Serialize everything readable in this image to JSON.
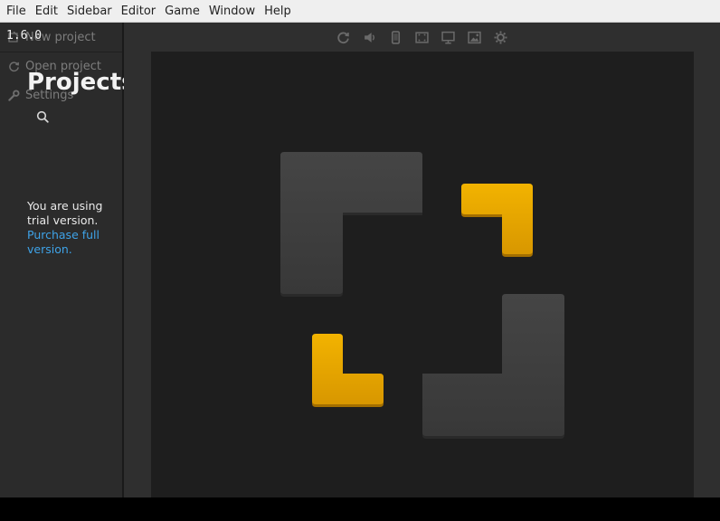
{
  "menubar": {
    "items": [
      "File",
      "Edit",
      "Sidebar",
      "Editor",
      "Game",
      "Window",
      "Help"
    ]
  },
  "sidebar": {
    "version": "1.6.0",
    "new_project": "New project",
    "open_project": "Open project",
    "settings": "Settings",
    "projects_title": "Projects",
    "trial_text": "You are using trial version.",
    "purchase_link": "Purchase full version."
  },
  "toolbar": {
    "icons": [
      "refresh-icon",
      "sound-icon",
      "phone-icon",
      "fullscreen-icon",
      "monitor-icon",
      "screenshot-icon",
      "settings-gear-icon"
    ]
  },
  "colors": {
    "gold": "#e8a500",
    "tile_gray": "#3d3d3d",
    "link": "#3ea3e8"
  }
}
